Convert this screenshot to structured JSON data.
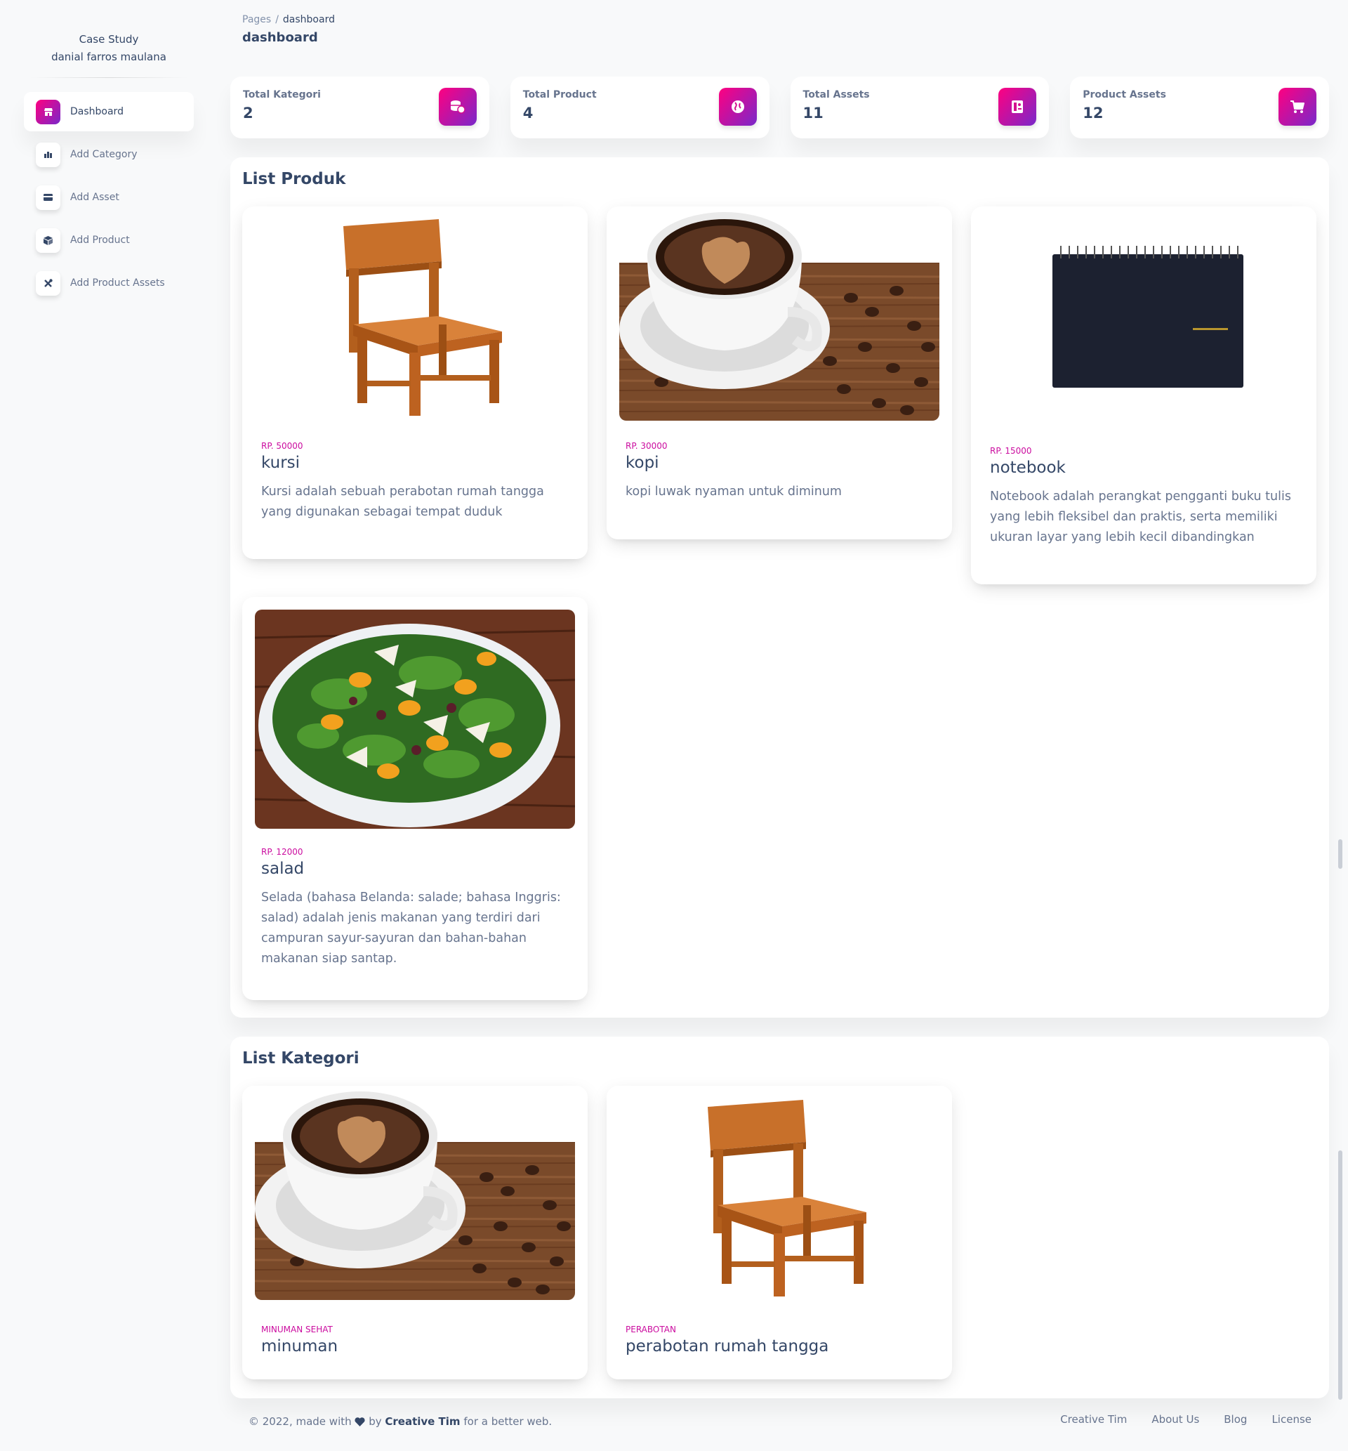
{
  "brand": {
    "line1": "Case Study",
    "line2": "danial farros maulana"
  },
  "sidebar": {
    "items": [
      {
        "label": "Dashboard",
        "icon": "shop-icon",
        "active": true
      },
      {
        "label": "Add Category",
        "icon": "chart-icon"
      },
      {
        "label": "Add Asset",
        "icon": "credit-card-icon"
      },
      {
        "label": "Add Product",
        "icon": "box-icon"
      },
      {
        "label": "Add Product Assets",
        "icon": "tools-icon"
      }
    ]
  },
  "breadcrumb": {
    "root": "Pages",
    "separator": "/",
    "current": "dashboard"
  },
  "page": {
    "title": "dashboard"
  },
  "stats": [
    {
      "label": "Total Kategori",
      "value": "2",
      "icon": "coins-icon"
    },
    {
      "label": "Total Product",
      "value": "4",
      "icon": "globe-icon"
    },
    {
      "label": "Total Assets",
      "value": "11",
      "icon": "document-icon"
    },
    {
      "label": "Product Assets",
      "value": "12",
      "icon": "cart-icon"
    }
  ],
  "produk": {
    "title": "List Produk",
    "items": [
      {
        "price": "RP. 50000",
        "name": "kursi",
        "desc": "Kursi adalah sebuah perabotan rumah tangga yang digunakan sebagai tempat duduk",
        "image": "chair"
      },
      {
        "price": "RP. 30000",
        "name": "kopi",
        "desc": "kopi luwak nyaman untuk diminum",
        "image": "coffee"
      },
      {
        "price": "RP. 15000",
        "name": "notebook",
        "desc": "Notebook adalah perangkat pengganti buku tulis yang lebih fleksibel dan praktis, serta memiliki ukuran layar yang lebih kecil dibandingkan",
        "image": "notebook"
      },
      {
        "price": "RP. 12000",
        "name": "salad",
        "desc": "Selada (bahasa Belanda: salade; bahasa Inggris: salad) adalah jenis makanan yang terdiri dari campuran sayur-sayuran dan bahan-bahan makanan siap santap.",
        "image": "salad"
      }
    ]
  },
  "kategori": {
    "title": "List Kategori",
    "items": [
      {
        "tag": "MINUMAN SEHAT",
        "name": "minuman",
        "image": "coffee"
      },
      {
        "tag": "PERABOTAN",
        "name": "perabotan rumah tangga",
        "image": "chair"
      }
    ]
  },
  "footer": {
    "copyright": "© 2022, made with",
    "by": "by",
    "author": "Creative Tim",
    "suffix": "for a better web.",
    "links": [
      "Creative Tim",
      "About Us",
      "Blog",
      "License"
    ]
  },
  "colors": {
    "accent_start": "#7928ca",
    "accent_end": "#ff0080",
    "price": "#cb0c9f",
    "text": "#344767",
    "muted": "#67748e"
  }
}
